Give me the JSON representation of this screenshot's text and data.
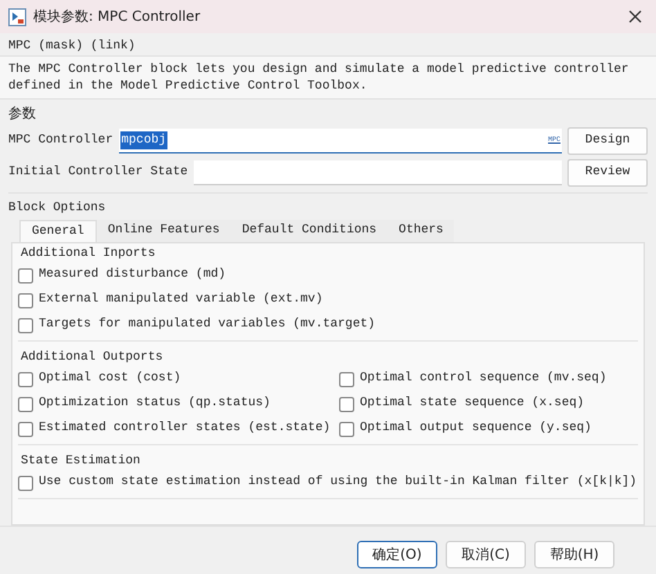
{
  "window": {
    "title": "模块参数: MPC Controller"
  },
  "mask_header": "MPC (mask) (link)",
  "description": "The MPC Controller block lets you design and simulate a model predictive controller defined in the Model Predictive Control Toolbox.",
  "parameters": {
    "title": "参数",
    "fields": [
      {
        "label": "MPC Controller",
        "value": "mpcobj",
        "selected": true,
        "suffix": "MPC",
        "button": "Design"
      },
      {
        "label": "Initial Controller State",
        "selected": false,
        "button": "Review"
      }
    ]
  },
  "block_options": {
    "title": "Block Options",
    "tabs": [
      {
        "label": "General",
        "selected": true
      },
      {
        "label": "Online Features",
        "selected": false
      },
      {
        "label": "Default Conditions",
        "selected": false
      },
      {
        "label": "Others",
        "selected": false
      }
    ],
    "groups": [
      {
        "title": "Additional Inports",
        "kind": "list",
        "items": [
          {
            "label": "Measured disturbance (md)",
            "checked": false
          },
          {
            "label": "External manipulated variable (ext.mv)",
            "checked": false
          },
          {
            "label": "Targets for manipulated variables (mv.target)",
            "checked": false
          }
        ]
      },
      {
        "title": "Additional Outports",
        "kind": "grid",
        "items": [
          {
            "label": "Optimal cost (cost)",
            "checked": false
          },
          {
            "label": "Optimal control sequence (mv.seq)",
            "checked": false
          },
          {
            "label": "Optimization status (qp.status)",
            "checked": false
          },
          {
            "label": "Optimal state sequence (x.seq)",
            "checked": false
          },
          {
            "label": "Estimated controller states (est.state)",
            "checked": false
          },
          {
            "label": "Optimal output sequence (y.seq)",
            "checked": false
          }
        ]
      },
      {
        "title": "State Estimation",
        "kind": "list",
        "items": [
          {
            "label": "Use custom state estimation instead of using the built-in Kalman filter (x[k|k])",
            "checked": false
          }
        ]
      }
    ]
  },
  "buttons": [
    {
      "label": "确定(O)",
      "default": true
    },
    {
      "label": "取消(C)",
      "default": false
    },
    {
      "label": "帮助(H)",
      "default": false
    }
  ]
}
